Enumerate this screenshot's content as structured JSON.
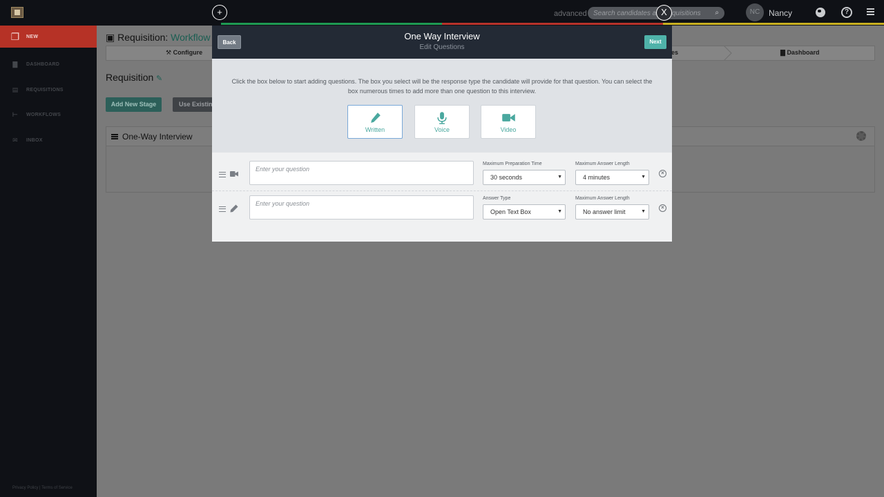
{
  "topbar": {
    "advanced_label": "advanced",
    "search_placeholder": "Search candidates and requisitions",
    "close_label": "X",
    "plus_label": "+",
    "user": {
      "initials": "NC",
      "name": "Nancy"
    },
    "help_label": "?",
    "stripe_colors": [
      "#1e9a53",
      "#b8322a",
      "#c9b020"
    ]
  },
  "sidebar": {
    "items": [
      {
        "label": "NEW",
        "icon": "new-document-icon",
        "active": true
      },
      {
        "label": "DASHBOARD",
        "icon": "bar-chart-icon"
      },
      {
        "label": "REQUISITIONS",
        "icon": "document-icon"
      },
      {
        "label": "WORKFLOWS",
        "icon": "workflow-icon"
      },
      {
        "label": "INBOX",
        "icon": "envelope-icon"
      }
    ],
    "footer": "Privacy Policy | Terms of Service"
  },
  "background": {
    "header_prefix": "Requisition:",
    "header_workflow": "Workflow",
    "steps": {
      "configure": "Configure",
      "partial": "es",
      "dashboard": "Dashboard"
    },
    "page_title": "Requisition",
    "add_stage_button": "Add New Stage",
    "use_existing_button": "Use Existing",
    "stage_title": "One-Way Interview"
  },
  "modal": {
    "title": "One Way Interview",
    "subtitle": "Edit Questions",
    "back_button": "Back",
    "next_button": "Next",
    "intro": "Click the box below to start adding questions. The box you select will be the response type the candidate will provide for that question. You can select the box numerous times to add more than one question to this interview.",
    "types": [
      {
        "label": "Written",
        "icon": "pencil-icon",
        "selected": true
      },
      {
        "label": "Voice",
        "icon": "microphone-icon"
      },
      {
        "label": "Video",
        "icon": "video-camera-icon"
      }
    ],
    "questions": [
      {
        "type_icon": "video-camera-icon",
        "value": "",
        "placeholder": "Enter your question",
        "field1_label": "Maximum Preparation Time",
        "field1_value": "30 seconds",
        "field2_label": "Maximum Answer Length",
        "field2_value": "4 minutes"
      },
      {
        "type_icon": "pencil-icon",
        "value": "",
        "placeholder": "Enter your question",
        "field1_label": "Answer Type",
        "field1_value": "Open Text Box",
        "field2_label": "Maximum Answer Length",
        "field2_value": "No answer limit"
      }
    ],
    "accent_color": "#4fb2a9"
  }
}
